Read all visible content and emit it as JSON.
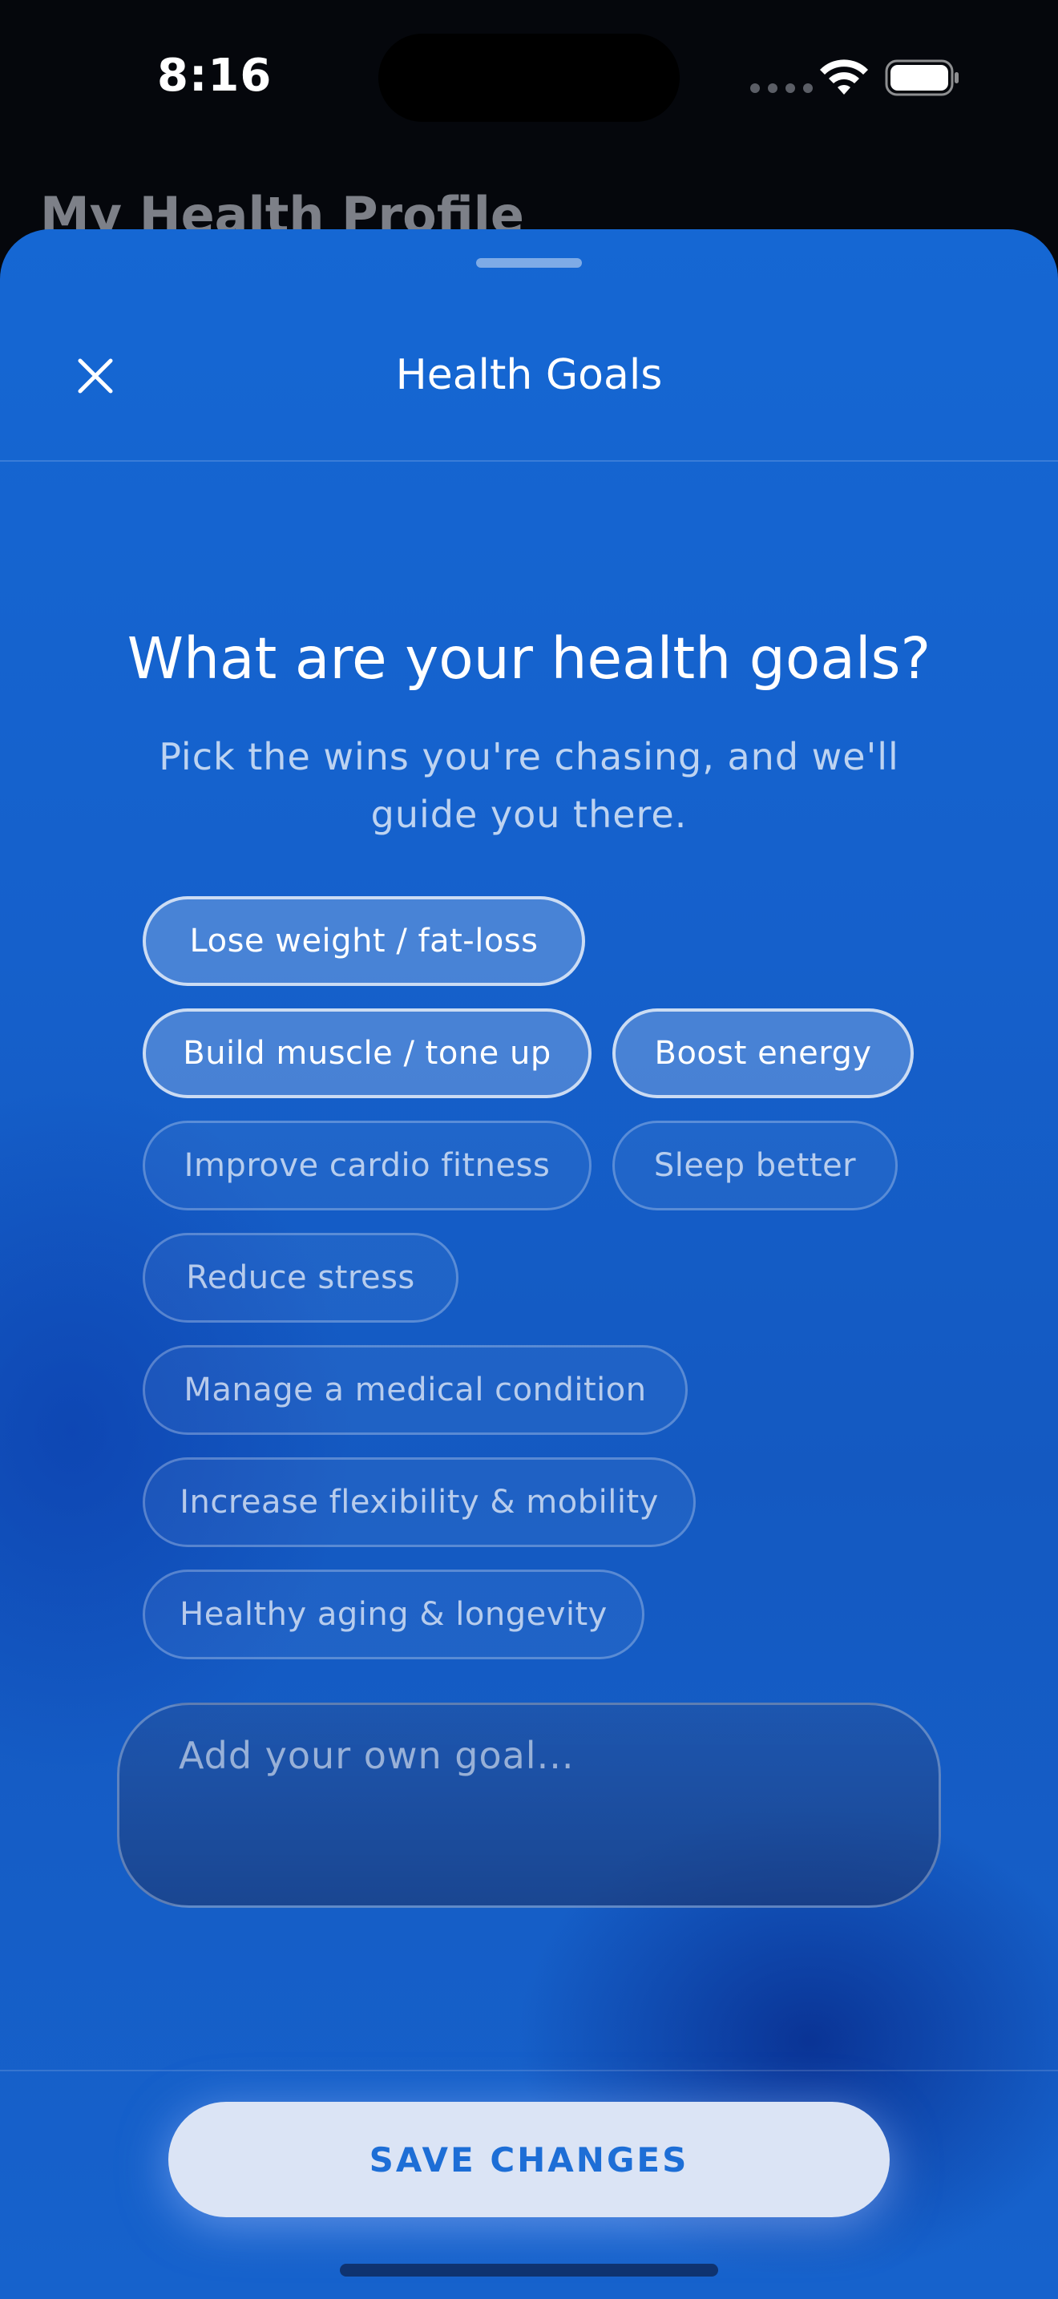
{
  "status_bar": {
    "time": "8:16"
  },
  "background": {
    "title": "My Health Profile"
  },
  "sheet": {
    "title": "Health Goals",
    "question": "What are your health goals?",
    "subtitle": "Pick the wins you're chasing, and we'll guide you there.",
    "goals": [
      {
        "label": "Lose weight / fat-loss",
        "selected": true
      },
      {
        "label": "Build muscle / tone up",
        "selected": true
      },
      {
        "label": "Boost energy",
        "selected": true
      },
      {
        "label": "Improve cardio fitness",
        "selected": false
      },
      {
        "label": "Sleep better",
        "selected": false
      },
      {
        "label": "Reduce stress",
        "selected": false
      },
      {
        "label": "Manage a medical condition",
        "selected": false
      },
      {
        "label": "Increase flexibility & mobility",
        "selected": false
      },
      {
        "label": "Healthy aging & longevity",
        "selected": false
      }
    ],
    "custom_goal": {
      "placeholder": "Add your own goal...",
      "value": ""
    },
    "save_label": "SAVE CHANGES"
  },
  "icons": {
    "close": "close-icon",
    "wifi": "wifi-icon",
    "battery": "battery-icon",
    "cellular": "cellular-dots-icon"
  }
}
